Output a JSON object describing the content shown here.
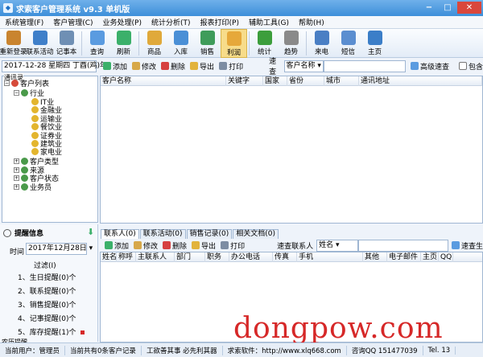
{
  "window": {
    "title": "求索客户管理系统 v9.3 单机版"
  },
  "menu": [
    "系统管理(F)",
    "客户管理(C)",
    "业务处理(P)",
    "统计分析(T)",
    "报表打印(P)",
    "辅助工具(G)",
    "帮助(H)"
  ],
  "toolbar": [
    {
      "label": "重新登录",
      "icon": "relogin-icon",
      "color": "#c9842f"
    },
    {
      "label": "联系活动",
      "icon": "contact-activity-icon",
      "color": "#3f7fc9"
    },
    {
      "label": "记事本",
      "icon": "notepad-icon",
      "color": "#6f8fb4"
    },
    {
      "label": "查询",
      "icon": "search-icon",
      "color": "#5a9be0"
    },
    {
      "label": "刷新",
      "icon": "refresh-icon",
      "color": "#3bb06a"
    },
    {
      "label": "商品",
      "icon": "product-icon",
      "color": "#e0a93a"
    },
    {
      "label": "入库",
      "icon": "stock-in-icon",
      "color": "#4a8fd6"
    },
    {
      "label": "销售",
      "icon": "sales-icon",
      "color": "#3f9c5a"
    },
    {
      "label": "利润",
      "icon": "profit-icon",
      "color": "#e6a83a"
    },
    {
      "label": "统计",
      "icon": "statistics-icon",
      "color": "#3c9e3c"
    },
    {
      "label": "趋势",
      "icon": "trend-icon",
      "color": "#8a8a8a"
    },
    {
      "label": "来电",
      "icon": "incoming-call-icon",
      "color": "#4a7fc4"
    },
    {
      "label": "短信",
      "icon": "sms-icon",
      "color": "#5b8ed0"
    },
    {
      "label": "主页",
      "icon": "home-icon",
      "color": "#3b7ec8"
    }
  ],
  "date_display": "2017-12-28 星期四 丁酉(鸡)年",
  "actions": {
    "add": "添加",
    "edit": "修改",
    "delete": "删除",
    "export": "导出",
    "print": "打印"
  },
  "search": {
    "label": "速查",
    "field": "客户名称",
    "adv": "高级速查",
    "contains": "包含"
  },
  "tree": {
    "header": "通讯录",
    "root": "客户列表",
    "industry": "行业",
    "industries": [
      "IT业",
      "金融业",
      "运输业",
      "餐饮业",
      "证券业",
      "建筑业",
      "家电业"
    ],
    "others": [
      "客户类型",
      "来源",
      "客户状态",
      "业务员"
    ]
  },
  "grid_top": {
    "columns": [
      "客户名称",
      "关键字",
      "国家",
      "省份",
      "城市",
      "通讯地址"
    ]
  },
  "remind": {
    "title": "提醒信息",
    "time_label": "时间",
    "time_value": "2017年12月28日",
    "expired": "过滤(I)",
    "items": [
      "1、生日提醒(0)个",
      "2、联系提醒(0)个",
      "3、销售提醒(0)个",
      "4、记事提醒(0)个",
      "5、库存提醒(1)个"
    ],
    "footer": "农历提醒"
  },
  "tabs": [
    "联系人(0)",
    "联系活动(0)",
    "销售记录(0)",
    "相关文档(0)"
  ],
  "contact_search": {
    "label": "速查联系人",
    "field": "姓名",
    "btn": "速查生"
  },
  "grid_bottom": {
    "columns": [
      "姓名",
      "称呼",
      "主联系人",
      "部门",
      "职务",
      "办公电话",
      "传真",
      "手机",
      "其他",
      "电子邮件",
      "主页",
      "QQ"
    ]
  },
  "status": [
    "当前用户：管理员",
    "当前共有0条客户记录",
    "工欲善其事 必先利其器",
    "求索软件：http://www.xlq668.com",
    "咨询QQ 151477039",
    "Tel. 13"
  ],
  "watermark": "dongpow.com"
}
